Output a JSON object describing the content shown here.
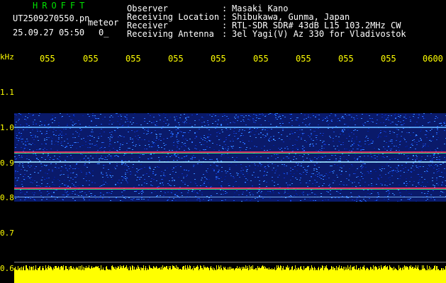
{
  "header": {
    "station_name": "HROFFT",
    "filename": "UT2509270550.pn",
    "mode_label": "meteor",
    "date_time": "25.09.27 05:50",
    "count": "0_",
    "fields": [
      {
        "label": "Observer",
        "value": "Masaki Kano"
      },
      {
        "label": "Receiving Location",
        "value": "Shibukawa, Gunma, Japan"
      },
      {
        "label": "Receiver",
        "value": "RTL-SDR SDR# 43dB L15 103.2MHz CW"
      },
      {
        "label": "Receiving Antenna",
        "value": "3el Yagi(V) Az 330 for Vladivostok"
      }
    ]
  },
  "axes": {
    "unit": "kHz",
    "freq_ticks": [
      "1.1",
      "1.0",
      "0.9",
      "0.8",
      "0.7",
      "0.6"
    ],
    "time_ticks": [
      "055",
      "055",
      "055",
      "055",
      "055",
      "055",
      "055",
      "055",
      "055",
      "0600"
    ]
  },
  "colors": {
    "text_white": "#ffffff",
    "text_yellow": "#ffff00",
    "title_green": "#00e000",
    "power_yellow": "#ffff00"
  }
}
